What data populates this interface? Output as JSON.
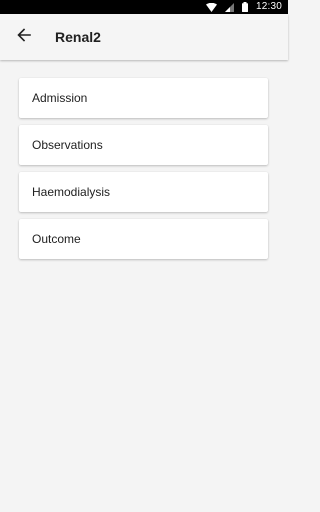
{
  "status_bar": {
    "time": "12:30",
    "icons": [
      "wifi-icon",
      "signal-icon",
      "battery-icon"
    ]
  },
  "app_bar": {
    "back_icon": "arrow-left-icon",
    "title": "Renal2"
  },
  "menu": {
    "items": [
      {
        "label": "Admission"
      },
      {
        "label": "Observations"
      },
      {
        "label": "Haemodialysis"
      },
      {
        "label": "Outcome"
      }
    ]
  },
  "colors": {
    "background": "#f4f4f4",
    "app_bar": "#f5f5f5",
    "card": "#ffffff",
    "text": "#212121",
    "status_bar": "#000000"
  }
}
